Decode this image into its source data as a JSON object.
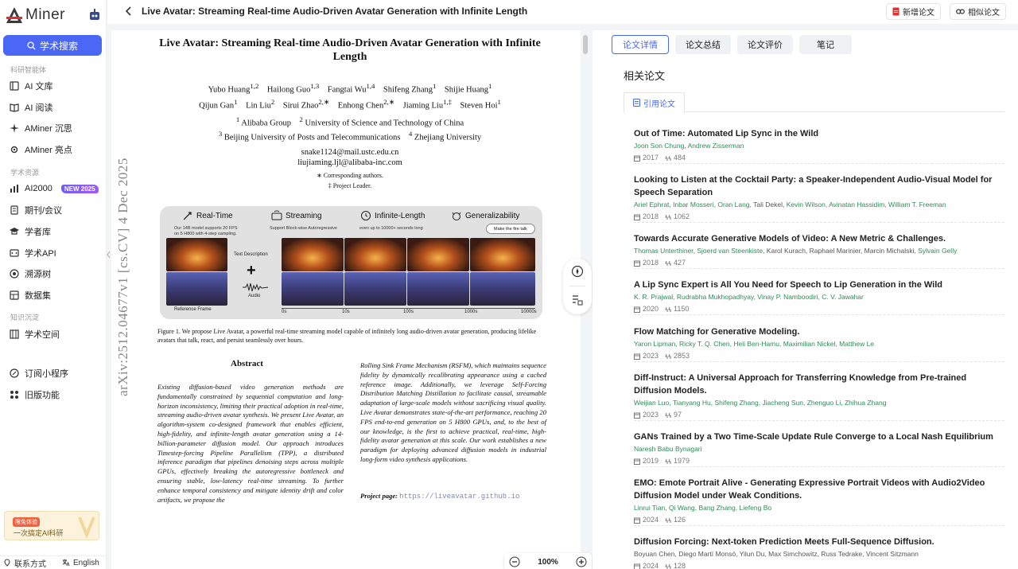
{
  "app": {
    "logo_text": "Miner",
    "search_label": "学术搜索"
  },
  "sidebar": {
    "sections": [
      "科研智能体",
      "学术资源",
      "知识沉淀"
    ],
    "items": [
      {
        "label": "AI 文库",
        "icon": "library-icon"
      },
      {
        "label": "AI 阅读",
        "icon": "book-open-icon"
      },
      {
        "label": "AMiner 沉思",
        "icon": "sparkle-icon"
      },
      {
        "label": "AMiner 亮点",
        "icon": "gear-icon"
      },
      {
        "label": "AI2000",
        "icon": "chart-icon",
        "badge": "NEW 2025"
      },
      {
        "label": "期刊/会议",
        "icon": "journal-icon"
      },
      {
        "label": "学者库",
        "icon": "graduation-cap-icon"
      },
      {
        "label": "学术API",
        "icon": "api-icon"
      },
      {
        "label": "溯源树",
        "icon": "target-icon"
      },
      {
        "label": "数据集",
        "icon": "dataset-icon"
      },
      {
        "label": "学术空间",
        "icon": "space-icon"
      },
      {
        "label": "订阅小程序",
        "icon": "subscribe-icon"
      },
      {
        "label": "旧版功能",
        "icon": "grid-icon"
      }
    ],
    "promo": {
      "tag": "限免体验",
      "text": "一次搞定AI科研"
    },
    "bottom": {
      "contact": "联系方式",
      "language": "English"
    }
  },
  "header": {
    "title": "Live Avatar: Streaming Real-time Audio-Driven Avatar Generation with Infinite Length",
    "add_paper": "新增论文",
    "similar_paper": "相似论文"
  },
  "pdf": {
    "title_line1": "Live Avatar: Streaming Real-time Audio-Driven Avatar Generation with Infinite",
    "title_line2": "Length",
    "authors_line1": "Yubo Huang",
    "arxiv_id": "arXiv:2512.04677v1  [cs.CV]  4 Dec 2025",
    "emails": [
      "snake1124@mail.ustc.edu.cn",
      "liujiaming.ljl@alibaba-inc.com"
    ],
    "notes": [
      "∗ Corresponding authors.",
      "‡ Project Leader."
    ],
    "figure": {
      "headers": [
        "Real-Time",
        "Streaming",
        "Infinite-Length",
        "Generalizability"
      ],
      "subs": [
        "Our 14B model supports 20 FPS",
        "on 5 H800 with 4-step sampling.",
        "Support Block-wise Autoregressive",
        "even up to 10000+ seconds long"
      ],
      "bubble": "Make the fire talk",
      "text_desc": "Text Description",
      "audio": "Audio",
      "ref_frame": "Reference Frame",
      "ticks": [
        "0s",
        "10s",
        "100s",
        "1000s",
        "10000s"
      ]
    },
    "caption": "Figure 1. We propose Live Avatar, a powerful real-time streaming model capable of infinitely long audio-driven avatar generation, producing lifelike avatars that talk, react, and persist seamlessly over hours.",
    "abstract_heading": "Abstract",
    "abstract_left": "Existing diffusion-based video generation methods are fundamentally constrained by sequential computation and long-horizon inconsistency, limiting their practical adoption in real-time, streaming audio-driven avatar synthesis. We present Live Avatar, an algorithm-system co-designed framework that enables efficient, high-fidelity, and infinite-length avatar generation using a 14-billion-parameter diffusion model. Our approach introduces Timestep-forcing Pipeline Parallelism (TPP), a distributed inference paradigm that pipelines denoising steps across multiple GPUs, effectively breaking the autoregressive bottleneck and ensuring stable, low-latency real-time streaming. To further enhance temporal consistency and mitigate identity drift and color artifacts, we propose the",
    "abstract_right": "Rolling Sink Frame Mechanism (RSFM), which maintains sequence fidelity by dynamically recalibrating appearance using a cached reference image. Additionally, we leverage Self-Forcing Distribution Matching Distillation to facilitate causal, streamable adaptation of large-scale models without sacrificing visual quality. Live Avatar demonstrates state-of-the-art performance, reaching 20 FPS end-to-end generation on 5 H800 GPUs, and, to the best of our knowledge, is the first to achieve practical, real-time, high-fidelity avatar generation at this scale. Our work establishes a new paradigm for deploying advanced diffusion models in industrial long-form video synthesis applications.",
    "project_label": "Project page:",
    "project_url": "https://liveavatar.github.io"
  },
  "zoom": {
    "level": "100%"
  },
  "right": {
    "tabs": [
      "论文详情",
      "论文总结",
      "论文评价",
      "笔记"
    ],
    "active_tab": 0,
    "related_title": "相关论文",
    "subtab": "引用论文",
    "papers": [
      {
        "title": "Out of Time: Automated Lip Sync in the Wild",
        "authors": [
          [
            "Joon Son Chung",
            1
          ],
          [
            "Andrew Zisserman",
            1
          ]
        ],
        "year": "2017",
        "cites": "484"
      },
      {
        "title": "Looking to Listen at the Cocktail Party: a Speaker-Independent Audio-Visual Model for Speech Separation",
        "authors": [
          [
            "Ariel Ephrat",
            1
          ],
          [
            "Inbar Mosseri",
            1
          ],
          [
            "Oran Lang",
            1
          ],
          [
            "Tali Dekel",
            0
          ],
          [
            "Kevin Wilson",
            1
          ],
          [
            "Avinatan Hassidim",
            1
          ],
          [
            "William T. Freeman",
            1
          ]
        ],
        "year": "2018",
        "cites": "1062"
      },
      {
        "title": "Towards Accurate Generative Models of Video: A New Metric & Challenges.",
        "authors": [
          [
            "Thomas Unterthiner",
            1
          ],
          [
            "Sjoerd van Steenkiste",
            1
          ],
          [
            "Karol Kurach",
            0
          ],
          [
            "Raphael Marinier",
            0
          ],
          [
            "Marcin Michalski",
            0
          ],
          [
            "Sylvain Gelly",
            1
          ]
        ],
        "year": "2018",
        "cites": "427"
      },
      {
        "title": "A Lip Sync Expert is All You Need for Speech to Lip Generation in the Wild",
        "authors": [
          [
            "K. R. Prajwal",
            1
          ],
          [
            "Rudrabha Mukhopadhyay",
            1
          ],
          [
            "Vinay P. Namboodiri",
            1
          ],
          [
            "C. V. Jawahar",
            1
          ]
        ],
        "year": "2020",
        "cites": "1150"
      },
      {
        "title": "Flow Matching for Generative Modeling.",
        "authors": [
          [
            "Yaron Lipman",
            1
          ],
          [
            "Ricky T. Q. Chen",
            1
          ],
          [
            "Heli Ben-Hamu",
            1
          ],
          [
            "Maximilian Nickel",
            1
          ],
          [
            "Matthew Le",
            1
          ]
        ],
        "year": "2023",
        "cites": "2853"
      },
      {
        "title": "Diff-Instruct: A Universal Approach for Transferring Knowledge from Pre-trained Diffusion Models.",
        "authors": [
          [
            "Weijian Luo",
            1
          ],
          [
            "Tianyang Hu",
            1
          ],
          [
            "Shifeng Zhang",
            1
          ],
          [
            "Jiacheng Sun",
            1
          ],
          [
            "Zhenguo Li",
            1
          ],
          [
            "Zhihua Zhang",
            1
          ]
        ],
        "year": "2023",
        "cites": "97"
      },
      {
        "title": "GANs Trained by a Two Time-Scale Update Rule Converge to a Local Nash Equilibrium",
        "authors": [
          [
            "Naresh Babu Bynagari",
            1
          ]
        ],
        "year": "2019",
        "cites": "1979"
      },
      {
        "title": "EMO: Emote Portrait Alive - Generating Expressive Portrait Videos with Audio2Video Diffusion Model under Weak Conditions.",
        "authors": [
          [
            "Linrui Tian",
            1
          ],
          [
            "Qi Wang",
            1
          ],
          [
            "Bang Zhang",
            1
          ],
          [
            "Liefeng Bo",
            1
          ]
        ],
        "year": "2024",
        "cites": "126"
      },
      {
        "title": "Diffusion Forcing: Next-token Prediction Meets Full-Sequence Diffusion.",
        "authors": [
          [
            "Boyuan Chen",
            0
          ],
          [
            "Diego Martí Monsó",
            0
          ],
          [
            "Yilun Du",
            0
          ],
          [
            "Max Simchowitz",
            0
          ],
          [
            "Russ Tedrake",
            0
          ],
          [
            "Vincent Sitzmann",
            0
          ]
        ],
        "year": "2024",
        "cites": "128"
      }
    ]
  },
  "colors": {
    "accent": "#4a67f5",
    "author_link": "#2e8b57"
  }
}
